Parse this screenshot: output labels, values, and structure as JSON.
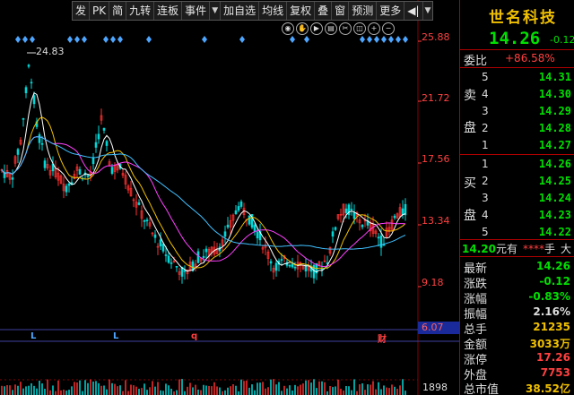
{
  "toolbar": {
    "items": [
      "发",
      "PK",
      "简",
      "九转",
      "连板",
      "事件",
      "▼",
      "加自选",
      "均线",
      "复权",
      "叠",
      "窗",
      "预测",
      "更多",
      "◀|",
      "▼"
    ]
  },
  "chart": {
    "y_axis_labels": [
      "25.88",
      "21.72",
      "17.56",
      "13.34",
      "9.18",
      "6.07"
    ],
    "peak_label": "24.83",
    "volume_axis_label": "1898",
    "markers": [
      {
        "text": "L",
        "color": "#4da6ff"
      },
      {
        "text": "L",
        "color": "#4da6ff"
      },
      {
        "text": "q",
        "color": "#ff4040"
      },
      {
        "text": "财",
        "color": "#ff4040"
      }
    ],
    "colors": {
      "up": "#ff3030",
      "down": "#00d8d8",
      "ma5": "#ffffff",
      "ma10": "#f0c000",
      "ma20": "#ff40ff",
      "ma60": "#40c0ff",
      "grid": "#8a0000"
    }
  },
  "toolbar_icons": [
    "eye-icon",
    "hand-icon",
    "play-icon",
    "chart-icon",
    "scissors-icon",
    "layers-icon",
    "plus-icon",
    "minus-icon"
  ],
  "panel": {
    "name": "世名科技",
    "price": "14.26",
    "change": "-0.12",
    "weibi_label": "委比",
    "weibi_value": "+86.58%",
    "sell_label_1": "卖",
    "sell_label_2": "盘",
    "buy_label_1": "买",
    "buy_label_2": "盘",
    "sell": [
      {
        "level": "5",
        "price": "14.31"
      },
      {
        "level": "4",
        "price": "14.30"
      },
      {
        "level": "3",
        "price": "14.29"
      },
      {
        "level": "2",
        "price": "14.28"
      },
      {
        "level": "1",
        "price": "14.27"
      }
    ],
    "buy": [
      {
        "level": "1",
        "price": "14.26"
      },
      {
        "level": "2",
        "price": "14.25"
      },
      {
        "level": "3",
        "price": "14.24"
      },
      {
        "level": "4",
        "price": "14.23"
      },
      {
        "level": "5",
        "price": "14.22"
      }
    ],
    "trade": {
      "price": "14.20",
      "yu": "元有",
      "stars": "****",
      "shou": "手",
      "da": "大"
    },
    "stats": [
      {
        "label": "最新",
        "value": "14.26",
        "color": "g"
      },
      {
        "label": "涨跌",
        "value": "-0.12",
        "color": "g"
      },
      {
        "label": "涨幅",
        "value": "-0.83%",
        "color": "g"
      },
      {
        "label": "振幅",
        "value": "2.16%",
        "color": "w"
      },
      {
        "label": "总手",
        "value": "21235",
        "color": "y"
      },
      {
        "label": "金额",
        "value": "3033万",
        "color": "y"
      },
      {
        "label": "涨停",
        "value": "17.26",
        "color": "r"
      },
      {
        "label": "外盘",
        "value": "7753",
        "color": "r"
      },
      {
        "label": "总市值",
        "value": "38.52亿",
        "color": "y"
      }
    ]
  }
}
